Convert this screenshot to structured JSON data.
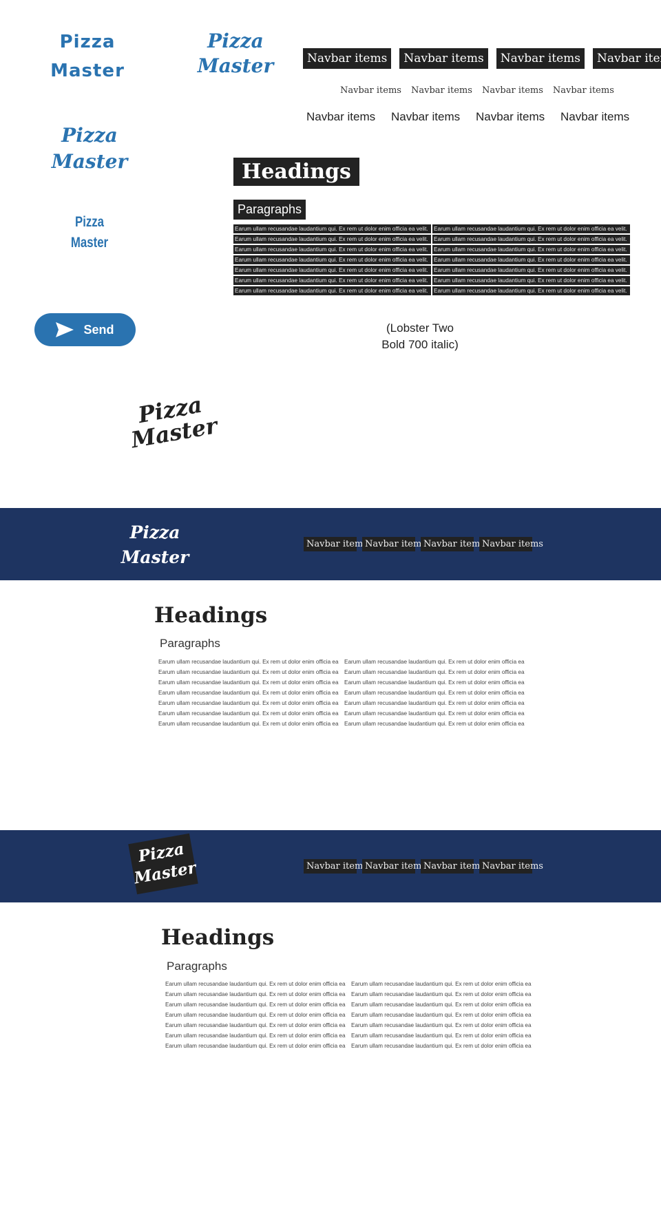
{
  "logos": {
    "logo_a": [
      "Pizza",
      "Master"
    ],
    "logo_b": [
      "Pizza",
      "Master"
    ],
    "logo_c": [
      "Pizza",
      "Master"
    ],
    "logo_d": [
      "Pizza",
      "Master"
    ],
    "logo_e": [
      "Pizza",
      "Master"
    ]
  },
  "navbar": {
    "items": [
      "Navbar items",
      "Navbar items",
      "Navbar items",
      "Navbar items"
    ]
  },
  "sample": {
    "heading": "Headings",
    "subheading": "Paragraphs",
    "paragraph_segment": "Earum ullam recusandae laudantium qui. Ex rem ut dolor enim officia ea velit."
  },
  "send_button": {
    "label": "Send",
    "icon": "send-icon"
  },
  "font_note": [
    "(Lobster Two",
    "Bold 700 italic)"
  ],
  "banners": {
    "banner1_logo": [
      "Pizza",
      "Master"
    ],
    "banner2_logo": [
      "Pizza",
      "Master"
    ]
  },
  "colors": {
    "accent_blue": "#2a73b0",
    "banner_navy": "#1e3461",
    "dark_block": "#222222"
  }
}
